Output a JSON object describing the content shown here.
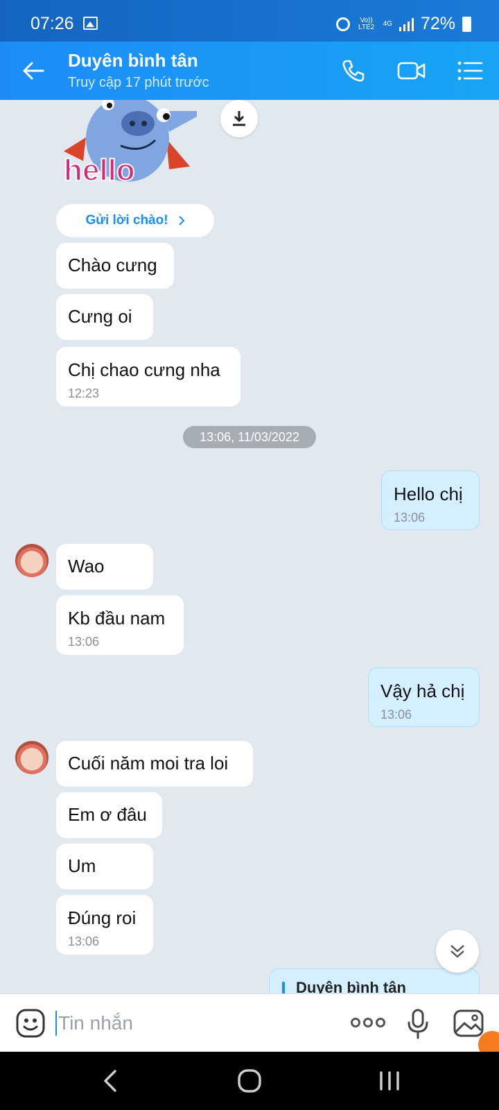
{
  "status_bar": {
    "time": "07:26",
    "battery": "72%",
    "network": "4G",
    "volte": "Vo)) LTE2"
  },
  "header": {
    "contact_name": "Duyên bình tân",
    "last_seen": "Truy cập 17 phút trước"
  },
  "chat": {
    "greet_button": "Gửi lời chào!",
    "date_separator": "13:06, 11/03/2022",
    "messages": [
      {
        "text": "Chào cưng",
        "time": ""
      },
      {
        "text": "Cưng oi",
        "time": ""
      },
      {
        "text": "Chị chao cưng nha",
        "time": "12:23"
      },
      {
        "text": "Hello chị",
        "time": "13:06"
      },
      {
        "text": "Wao",
        "time": ""
      },
      {
        "text": "Kb đầu nam",
        "time": "13:06"
      },
      {
        "text": "Vậy hả chị",
        "time": "13:06"
      },
      {
        "text": "Cuối năm moi tra loi",
        "time": ""
      },
      {
        "text": "Em ơ đâu",
        "time": ""
      },
      {
        "text": "Um",
        "time": ""
      },
      {
        "text": "Đúng roi",
        "time": "13:06"
      }
    ],
    "reply_preview_name": "Duyên bình tân"
  },
  "input": {
    "placeholder": "Tin nhắn"
  },
  "colors": {
    "header": "#1d8cf8",
    "outgoing_bubble": "#d4efff",
    "incoming_bubble": "#ffffff",
    "background": "#e2e8f0"
  },
  "icons": [
    "back-icon",
    "phone-icon",
    "video-icon",
    "menu-icon",
    "download-icon",
    "chevron-right-icon",
    "double-chevron-down-icon",
    "emoji-icon",
    "more-icon",
    "mic-icon",
    "image-icon",
    "nav-back-icon",
    "nav-home-icon",
    "nav-recents-icon"
  ]
}
